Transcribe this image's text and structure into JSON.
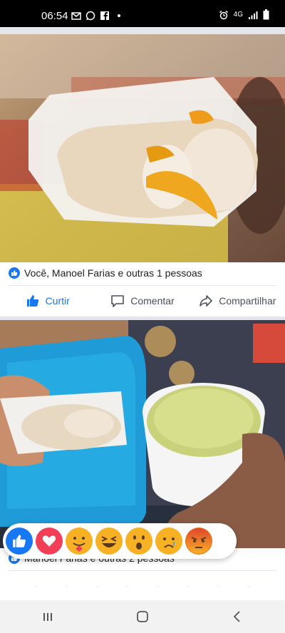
{
  "status_bar": {
    "time": "06:54",
    "notification_icons": [
      "gmail-icon",
      "whatsapp-icon",
      "facebook-icon",
      "dot-icon"
    ],
    "right_icons": [
      "alarm-icon",
      "4g-icon",
      "signal-icon",
      "battery-icon"
    ],
    "network_label": "4G"
  },
  "post1": {
    "reactions_text": "Você, Manoel Farias e outras 1 pessoas",
    "actions": {
      "like": "Curtir",
      "comment": "Comentar",
      "share": "Compartilhar"
    },
    "like_color": "#1877f2"
  },
  "post2": {
    "reactions_text": "Manoel Farias e outras 2 pessoas"
  },
  "reaction_picker": {
    "items": [
      "like",
      "love",
      "care",
      "haha",
      "wow",
      "sad",
      "angry"
    ]
  },
  "nav": [
    "recent-apps",
    "home",
    "back"
  ]
}
